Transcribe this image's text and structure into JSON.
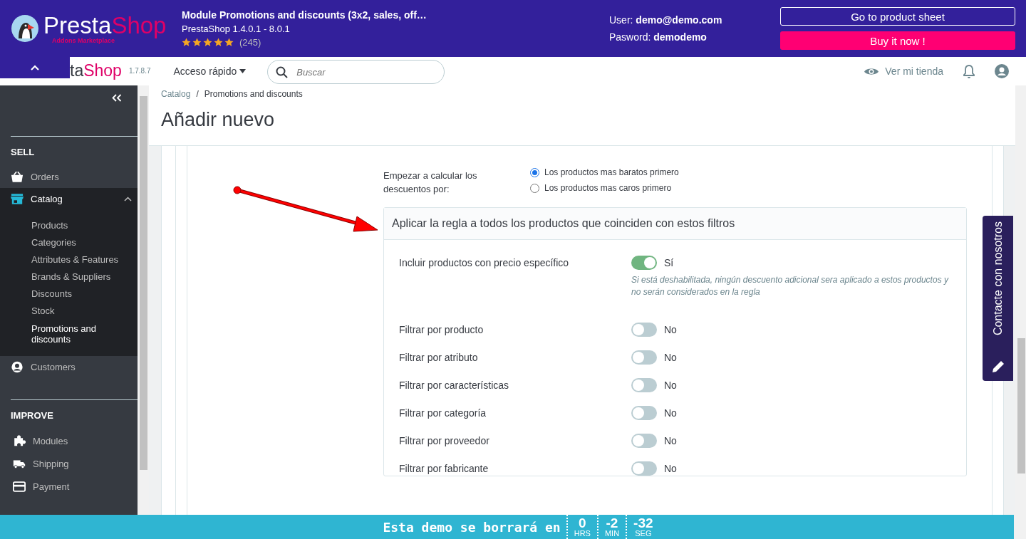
{
  "banner": {
    "logo": {
      "part1": "Presta",
      "part2": "Shop",
      "tagline": "Addons Marketplace"
    },
    "title": "Module Promotions and discounts (3x2, sales, off…",
    "subtitle": "PrestaShop 1.4.0.1 - 8.0.1",
    "stars": 5,
    "reviews": "(245)",
    "credentials": [
      "User: **demo@demo.com**",
      "Pasword: **demodemo**"
    ],
    "buttons": [
      {
        "label": "Go to product sheet",
        "kind": "outline"
      },
      {
        "label": "Buy it now !",
        "kind": "primary"
      }
    ]
  },
  "header": {
    "logo_dark": "ta",
    "logo_accent": "Shop",
    "version": "1.7.8.7",
    "quick_access": "Acceso rápido",
    "search": {
      "placeholder": "Buscar"
    },
    "view_store": "Ver mi tienda"
  },
  "sidebar": {
    "sections": [
      {
        "title": "SELL",
        "items": [
          {
            "label": "Orders",
            "selected": false
          },
          {
            "label": "Catalog",
            "selected": true,
            "expanded": true,
            "children": [
              {
                "label": "Products",
                "selected": false
              },
              {
                "label": "Categories",
                "selected": false
              },
              {
                "label": "Attributes & Features",
                "selected": false
              },
              {
                "label": "Brands & Suppliers",
                "selected": false
              },
              {
                "label": "Discounts",
                "selected": false
              },
              {
                "label": "Stock",
                "selected": false
              },
              {
                "label": "Promotions and discounts",
                "selected": true
              }
            ]
          },
          {
            "label": "Customers",
            "selected": false
          }
        ]
      },
      {
        "title": "IMPROVE",
        "items": [
          {
            "label": "Modules",
            "selected": false
          },
          {
            "label": "Shipping",
            "selected": false
          },
          {
            "label": "Payment",
            "selected": false
          }
        ]
      }
    ]
  },
  "breadcrumb": [
    "Catalog",
    "Promotions and discounts"
  ],
  "breadcrumb_separator": "/",
  "page_title": "Añadir nuevo",
  "form": {
    "order_label": "Empezar a calcular los descuentos por:",
    "order_options": [
      {
        "label": "Los productos mas baratos primero",
        "selected": true
      },
      {
        "label": "Los productos mas caros primero",
        "selected": false
      }
    ],
    "panel": {
      "title": "Aplicar la regla a todos los productos que coinciden con estos filtros",
      "rows": [
        {
          "label": "Incluir productos con precio específico",
          "on": true,
          "state_text": "Sí",
          "help": "Si está deshabilitada, ningún descuento adicional sera aplicado a estos productos y no serán considerados en la regla"
        },
        {
          "label": "Filtrar por producto",
          "on": false,
          "state_text": "No"
        },
        {
          "label": "Filtrar por atributo",
          "on": false,
          "state_text": "No"
        },
        {
          "label": "Filtrar por características",
          "on": false,
          "state_text": "No"
        },
        {
          "label": "Filtrar por categoría",
          "on": false,
          "state_text": "No"
        },
        {
          "label": "Filtrar por proveedor",
          "on": false,
          "state_text": "No"
        },
        {
          "label": "Filtrar por fabricante",
          "on": false,
          "state_text": "No"
        }
      ]
    }
  },
  "contact_tab": "Contacte con nosotros",
  "countdown": {
    "message": "Esta demo se borrará en",
    "units": [
      {
        "value": "0",
        "label": "HRS"
      },
      {
        "value": "-2",
        "label": "MIN"
      },
      {
        "value": "-32",
        "label": "SEG"
      }
    ]
  }
}
